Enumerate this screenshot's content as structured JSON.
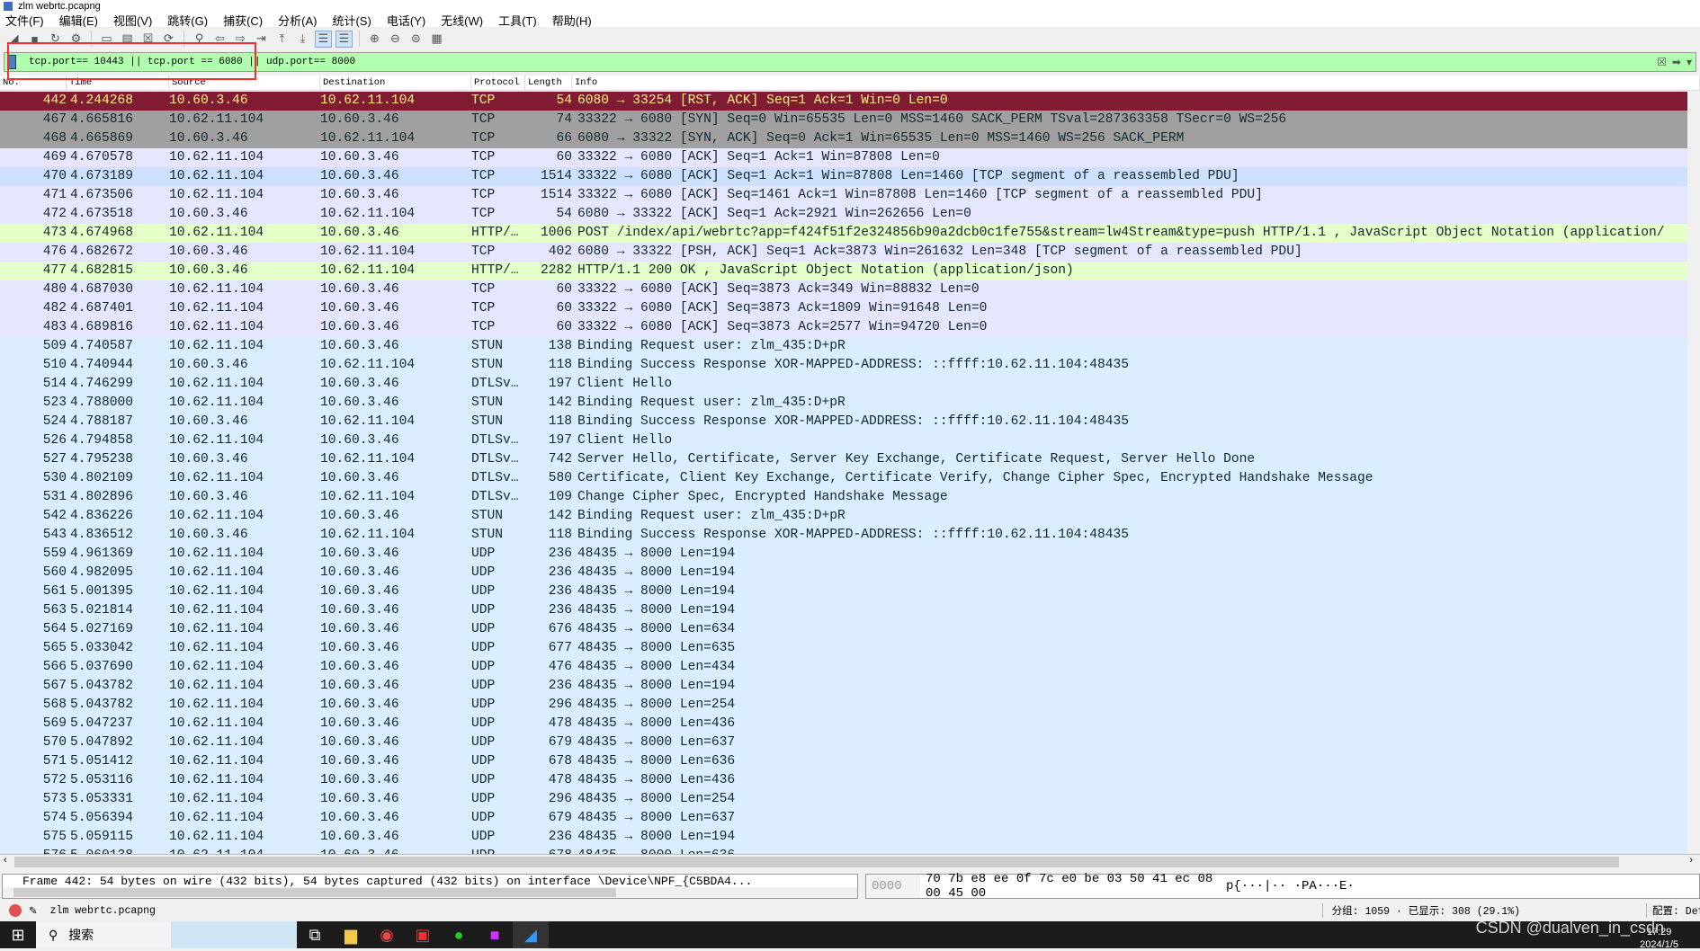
{
  "window": {
    "title": "zlm webrtc.pcapng"
  },
  "menu": [
    "文件(F)",
    "编辑(E)",
    "视图(V)",
    "跳转(G)",
    "捕获(C)",
    "分析(A)",
    "统计(S)",
    "电话(Y)",
    "无线(W)",
    "工具(T)",
    "帮助(H)"
  ],
  "toolbar": [
    "shark-fin-start-icon",
    "stop-icon",
    "restart-icon",
    "options-icon",
    "open-icon",
    "save-icon",
    "close-file-icon",
    "reload-icon",
    "find-icon",
    "back-icon",
    "forward-icon",
    "goto-icon",
    "first-icon",
    "last-icon",
    "autoscroll-icon",
    "colorize-icon",
    "zoom-in-icon",
    "zoom-out-icon",
    "zoom-reset-icon",
    "resize-columns-icon"
  ],
  "filter": {
    "value": "tcp.port== 10443 || tcp.port == 6080 || udp.port== 8000"
  },
  "columns": [
    "No.",
    "Time",
    "Source",
    "Destination",
    "Protocol",
    "Length",
    "Info"
  ],
  "colors": {
    "red_bg": "#7f1b33",
    "red_fg": "#fff080",
    "gray": "#a0a0a0",
    "tcp": "#e7e6ff",
    "http": "#e4ffc7",
    "udp": "#daeeff",
    "filter_ok": "#afffaf",
    "highlight_box": "#ff2a2a"
  },
  "packets": [
    [
      "442",
      "4.244268",
      "10.60.3.46",
      "10.62.11.104",
      "TCP",
      "54",
      "6080 → 33254 [RST, ACK] Seq=1 Ack=1 Win=0 Len=0",
      "red"
    ],
    [
      "467",
      "4.665816",
      "10.62.11.104",
      "10.60.3.46",
      "TCP",
      "74",
      "33322 → 6080 [SYN] Seq=0 Win=65535 Len=0 MSS=1460 SACK_PERM TSval=287363358 TSecr=0 WS=256",
      "gray"
    ],
    [
      "468",
      "4.665869",
      "10.60.3.46",
      "10.62.11.104",
      "TCP",
      "66",
      "6080 → 33322 [SYN, ACK] Seq=0 Ack=1 Win=65535 Len=0 MSS=1460 WS=256 SACK_PERM",
      "gray"
    ],
    [
      "469",
      "4.670578",
      "10.62.11.104",
      "10.60.3.46",
      "TCP",
      "60",
      "33322 → 6080 [ACK] Seq=1 Ack=1 Win=87808 Len=0",
      "lav"
    ],
    [
      "470",
      "4.673189",
      "10.62.11.104",
      "10.60.3.46",
      "TCP",
      "1514",
      "33322 → 6080 [ACK] Seq=1 Ack=1 Win=87808 Len=1460 [TCP segment of a reassembled PDU]",
      "sel"
    ],
    [
      "471",
      "4.673506",
      "10.62.11.104",
      "10.60.3.46",
      "TCP",
      "1514",
      "33322 → 6080 [ACK] Seq=1461 Ack=1 Win=87808 Len=1460 [TCP segment of a reassembled PDU]",
      "lav"
    ],
    [
      "472",
      "4.673518",
      "10.60.3.46",
      "10.62.11.104",
      "TCP",
      "54",
      "6080 → 33322 [ACK] Seq=1 Ack=2921 Win=262656 Len=0",
      "lav"
    ],
    [
      "473",
      "4.674968",
      "10.62.11.104",
      "10.60.3.46",
      "HTTP/…",
      "1006",
      "POST /index/api/webrtc?app=f424f51f2e324856b90a2dcb0c1fe755&stream=lw4Stream&type=push HTTP/1.1 , JavaScript Object Notation (application/",
      "http"
    ],
    [
      "476",
      "4.682672",
      "10.60.3.46",
      "10.62.11.104",
      "TCP",
      "402",
      "6080 → 33322 [PSH, ACK] Seq=1 Ack=3873 Win=261632 Len=348 [TCP segment of a reassembled PDU]",
      "lav"
    ],
    [
      "477",
      "4.682815",
      "10.60.3.46",
      "10.62.11.104",
      "HTTP/…",
      "2282",
      "HTTP/1.1 200 OK , JavaScript Object Notation (application/json)",
      "http"
    ],
    [
      "480",
      "4.687030",
      "10.62.11.104",
      "10.60.3.46",
      "TCP",
      "60",
      "33322 → 6080 [ACK] Seq=3873 Ack=349 Win=88832 Len=0",
      "lav"
    ],
    [
      "482",
      "4.687401",
      "10.62.11.104",
      "10.60.3.46",
      "TCP",
      "60",
      "33322 → 6080 [ACK] Seq=3873 Ack=1809 Win=91648 Len=0",
      "lav"
    ],
    [
      "483",
      "4.689816",
      "10.62.11.104",
      "10.60.3.46",
      "TCP",
      "60",
      "33322 → 6080 [ACK] Seq=3873 Ack=2577 Win=94720 Len=0",
      "lav"
    ],
    [
      "509",
      "4.740587",
      "10.62.11.104",
      "10.60.3.46",
      "STUN",
      "138",
      "Binding Request user: zlm_435:D+pR",
      "udp"
    ],
    [
      "510",
      "4.740944",
      "10.60.3.46",
      "10.62.11.104",
      "STUN",
      "118",
      "Binding Success Response XOR-MAPPED-ADDRESS: ::ffff:10.62.11.104:48435",
      "udp"
    ],
    [
      "514",
      "4.746299",
      "10.62.11.104",
      "10.60.3.46",
      "DTLSv…",
      "197",
      "Client Hello",
      "udp"
    ],
    [
      "523",
      "4.788000",
      "10.62.11.104",
      "10.60.3.46",
      "STUN",
      "142",
      "Binding Request user: zlm_435:D+pR",
      "udp"
    ],
    [
      "524",
      "4.788187",
      "10.60.3.46",
      "10.62.11.104",
      "STUN",
      "118",
      "Binding Success Response XOR-MAPPED-ADDRESS: ::ffff:10.62.11.104:48435",
      "udp"
    ],
    [
      "526",
      "4.794858",
      "10.62.11.104",
      "10.60.3.46",
      "DTLSv…",
      "197",
      "Client Hello",
      "udp"
    ],
    [
      "527",
      "4.795238",
      "10.60.3.46",
      "10.62.11.104",
      "DTLSv…",
      "742",
      "Server Hello, Certificate, Server Key Exchange, Certificate Request, Server Hello Done",
      "udp"
    ],
    [
      "530",
      "4.802109",
      "10.62.11.104",
      "10.60.3.46",
      "DTLSv…",
      "580",
      "Certificate, Client Key Exchange, Certificate Verify, Change Cipher Spec, Encrypted Handshake Message",
      "udp"
    ],
    [
      "531",
      "4.802896",
      "10.60.3.46",
      "10.62.11.104",
      "DTLSv…",
      "109",
      "Change Cipher Spec, Encrypted Handshake Message",
      "udp"
    ],
    [
      "542",
      "4.836226",
      "10.62.11.104",
      "10.60.3.46",
      "STUN",
      "142",
      "Binding Request user: zlm_435:D+pR",
      "udp"
    ],
    [
      "543",
      "4.836512",
      "10.60.3.46",
      "10.62.11.104",
      "STUN",
      "118",
      "Binding Success Response XOR-MAPPED-ADDRESS: ::ffff:10.62.11.104:48435",
      "udp"
    ],
    [
      "559",
      "4.961369",
      "10.62.11.104",
      "10.60.3.46",
      "UDP",
      "236",
      "48435 → 8000 Len=194",
      "udp"
    ],
    [
      "560",
      "4.982095",
      "10.62.11.104",
      "10.60.3.46",
      "UDP",
      "236",
      "48435 → 8000 Len=194",
      "udp"
    ],
    [
      "561",
      "5.001395",
      "10.62.11.104",
      "10.60.3.46",
      "UDP",
      "236",
      "48435 → 8000 Len=194",
      "udp"
    ],
    [
      "563",
      "5.021814",
      "10.62.11.104",
      "10.60.3.46",
      "UDP",
      "236",
      "48435 → 8000 Len=194",
      "udp"
    ],
    [
      "564",
      "5.027169",
      "10.62.11.104",
      "10.60.3.46",
      "UDP",
      "676",
      "48435 → 8000 Len=634",
      "udp"
    ],
    [
      "565",
      "5.033042",
      "10.62.11.104",
      "10.60.3.46",
      "UDP",
      "677",
      "48435 → 8000 Len=635",
      "udp"
    ],
    [
      "566",
      "5.037690",
      "10.62.11.104",
      "10.60.3.46",
      "UDP",
      "476",
      "48435 → 8000 Len=434",
      "udp"
    ],
    [
      "567",
      "5.043782",
      "10.62.11.104",
      "10.60.3.46",
      "UDP",
      "236",
      "48435 → 8000 Len=194",
      "udp"
    ],
    [
      "568",
      "5.043782",
      "10.62.11.104",
      "10.60.3.46",
      "UDP",
      "296",
      "48435 → 8000 Len=254",
      "udp"
    ],
    [
      "569",
      "5.047237",
      "10.62.11.104",
      "10.60.3.46",
      "UDP",
      "478",
      "48435 → 8000 Len=436",
      "udp"
    ],
    [
      "570",
      "5.047892",
      "10.62.11.104",
      "10.60.3.46",
      "UDP",
      "679",
      "48435 → 8000 Len=637",
      "udp"
    ],
    [
      "571",
      "5.051412",
      "10.62.11.104",
      "10.60.3.46",
      "UDP",
      "678",
      "48435 → 8000 Len=636",
      "udp"
    ],
    [
      "572",
      "5.053116",
      "10.62.11.104",
      "10.60.3.46",
      "UDP",
      "478",
      "48435 → 8000 Len=436",
      "udp"
    ],
    [
      "573",
      "5.053331",
      "10.62.11.104",
      "10.60.3.46",
      "UDP",
      "296",
      "48435 → 8000 Len=254",
      "udp"
    ],
    [
      "574",
      "5.056394",
      "10.62.11.104",
      "10.60.3.46",
      "UDP",
      "679",
      "48435 → 8000 Len=637",
      "udp"
    ],
    [
      "575",
      "5.059115",
      "10.62.11.104",
      "10.60.3.46",
      "UDP",
      "236",
      "48435 → 8000 Len=194",
      "udp"
    ],
    [
      "576",
      "5.060138",
      "10.62.11.104",
      "10.60.3.46",
      "UDP",
      "678",
      "48435 → 8000 Len=636",
      "udp"
    ]
  ],
  "detail": {
    "text": "Frame 442: 54 bytes on wire (432 bits), 54 bytes captured (432 bits) on interface \\Device\\NPF_{C5BDA4..."
  },
  "bytes": {
    "offset": "0000",
    "hex": "70 7b e8 ee 0f 7c e0 be  03 50 41 ec 08 00 45 00",
    "ascii": "p{···|·· ·PA···E·"
  },
  "status": {
    "file": "zlm webrtc.pcapng",
    "counts": "分组: 1059 · 已显示: 308 (29.1%)",
    "profile": "配置: Def"
  },
  "taskbar": {
    "search": "搜索",
    "watermark": "CSDN @dualven_in_csdn",
    "time": "17:29",
    "date": "2024/1/5"
  }
}
